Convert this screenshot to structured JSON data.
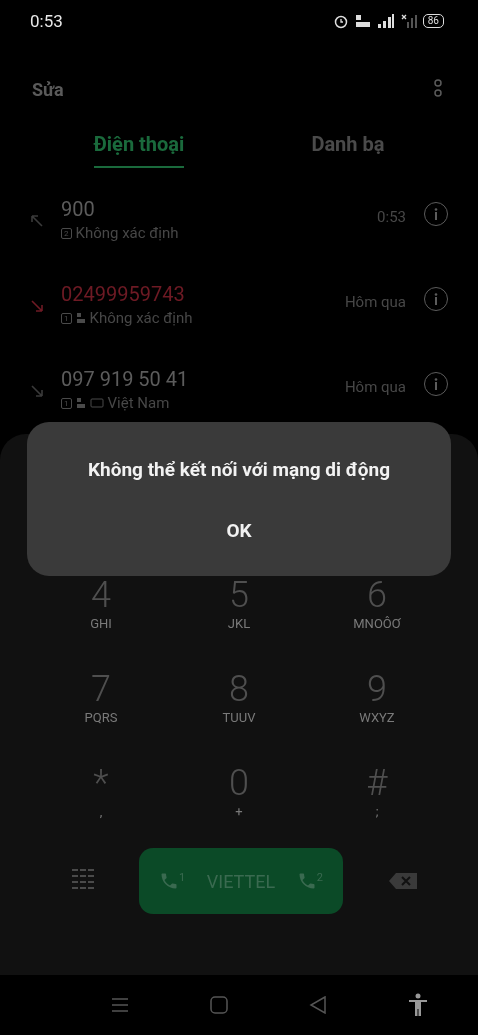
{
  "status_bar": {
    "time": "0:53",
    "battery": "86"
  },
  "header": {
    "edit": "Sửa"
  },
  "tabs": [
    {
      "label": "Điện thoại",
      "selected": true
    },
    {
      "label": "Danh bạ",
      "selected": false
    }
  ],
  "calls": [
    {
      "kind": "outgoing",
      "number": "900",
      "sim": "2",
      "volte": false,
      "hd": false,
      "place": "Không xác định",
      "time": "0:53"
    },
    {
      "kind": "missed",
      "number": "02499959743",
      "sim": "1",
      "volte": true,
      "hd": false,
      "place": "Không xác định",
      "time": "Hôm qua"
    },
    {
      "kind": "incoming",
      "number": "097 919 50 41",
      "sim": "1",
      "volte": true,
      "hd": true,
      "place": "Việt Nam",
      "time": "Hôm qua"
    }
  ],
  "keypad": [
    {
      "digit": "4",
      "letters": "GHI"
    },
    {
      "digit": "5",
      "letters": "JKL"
    },
    {
      "digit": "6",
      "letters": "MNOÔƠ"
    },
    {
      "digit": "7",
      "letters": "PQRS"
    },
    {
      "digit": "8",
      "letters": "TUUV"
    },
    {
      "digit": "9",
      "letters": "WXYZ"
    },
    {
      "digit": "*",
      "letters": ","
    },
    {
      "digit": "0",
      "letters": "+"
    },
    {
      "digit": "#",
      "letters": ";"
    }
  ],
  "call_button": {
    "label": "VIETTEL",
    "sim_1": "1",
    "sim_2": "2"
  },
  "dialog": {
    "message": "Không thể kết nối với mạng di động",
    "button": "OK"
  }
}
